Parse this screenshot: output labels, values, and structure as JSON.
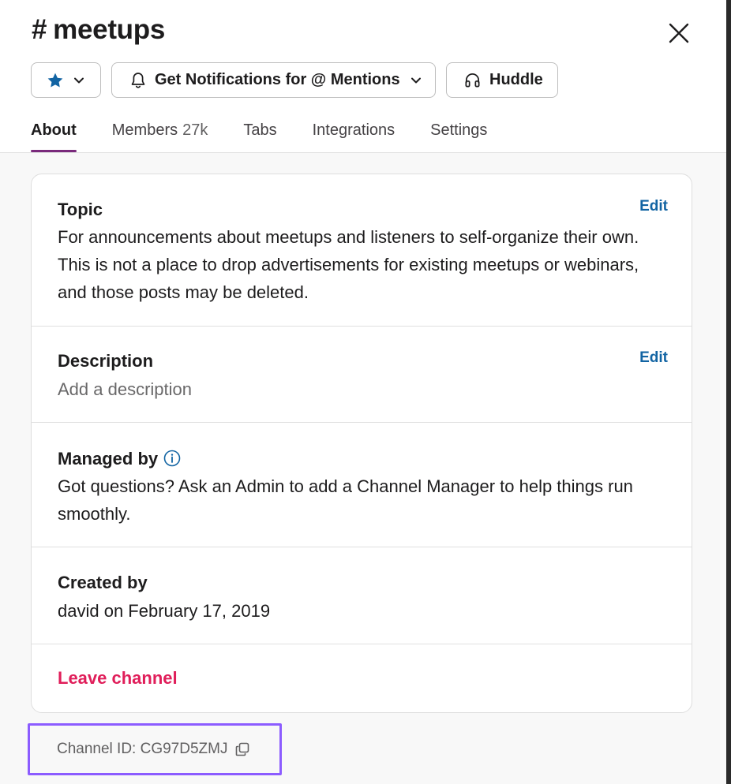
{
  "header": {
    "hash": "#",
    "channel_name": "meetups",
    "close_label": "Close"
  },
  "actions": {
    "star_icon": "star-icon",
    "notifications_label": "Get Notifications for @ Mentions",
    "huddle_label": "Huddle"
  },
  "tabs": [
    {
      "label": "About",
      "active": true
    },
    {
      "label": "Members",
      "count": "27k"
    },
    {
      "label": "Tabs"
    },
    {
      "label": "Integrations"
    },
    {
      "label": "Settings"
    }
  ],
  "about": {
    "topic": {
      "title": "Topic",
      "edit_label": "Edit",
      "text": "For announcements about meetups and listeners to self-organize their own. This is not a place to drop advertisements for existing meetups or webinars, and those posts may be deleted."
    },
    "description": {
      "title": "Description",
      "edit_label": "Edit",
      "placeholder": "Add a description"
    },
    "managed_by": {
      "title": "Managed by",
      "text": "Got questions? Ask an Admin to add a Channel Manager to help things run smoothly."
    },
    "created_by": {
      "title": "Created by",
      "text": "david on February 17, 2019"
    },
    "leave_label": "Leave channel"
  },
  "footer": {
    "channel_id_label": "Channel ID: CG97D5ZMJ"
  },
  "colors": {
    "accent_tab": "#7a2a7c",
    "link": "#1264a3",
    "danger": "#e01e5a",
    "highlight_box": "#8c5cff",
    "star": "#1264a3"
  }
}
